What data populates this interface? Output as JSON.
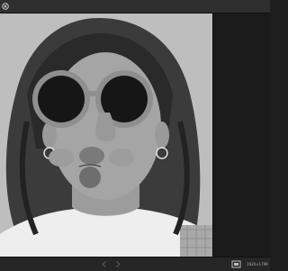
{
  "window": {
    "close_icon": "close-circle-icon"
  },
  "viewer": {
    "image_description_icon": "photo-icon"
  },
  "bottom_bar": {
    "prev_icon": "chevron-left-icon",
    "next_icon": "chevron-right-icon",
    "fit_icon": "fit-to-screen-icon",
    "image_dimensions": "1920×1799"
  },
  "colors": {
    "titlebar": "#2f2f2f",
    "panel": "#1b1b1b",
    "bottombar": "#262626",
    "text": "#b0b0b0"
  }
}
